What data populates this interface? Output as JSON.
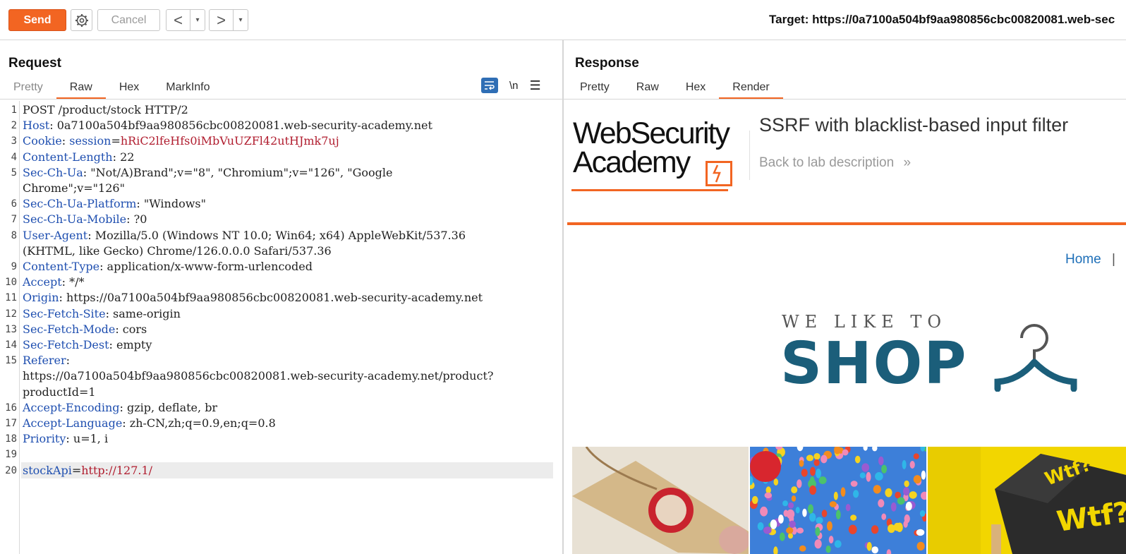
{
  "toolbar": {
    "send_label": "Send",
    "cancel_label": "Cancel",
    "back_arrow": "<",
    "forward_arrow": ">",
    "dropdown_glyph": "▾",
    "target_text": "Target: https://0a7100a504bf9aa980856cbc00820081.web-sec"
  },
  "request": {
    "title": "Request",
    "tabs": [
      "Pretty",
      "Raw",
      "Hex",
      "MarkInfo"
    ],
    "active_tab": "Raw",
    "newline_toggle": "\\n",
    "menu_glyph": "☰",
    "lines": [
      {
        "n": "1",
        "parts": [
          {
            "t": "POST /product/stock HTTP/2",
            "c": ""
          }
        ]
      },
      {
        "n": "2",
        "parts": [
          {
            "t": "Host",
            "c": "k"
          },
          {
            "t": ": 0a7100a504bf9aa980856cbc00820081.web-security-academy.net",
            "c": ""
          }
        ]
      },
      {
        "n": "3",
        "parts": [
          {
            "t": "Cookie",
            "c": "k"
          },
          {
            "t": ": ",
            "c": ""
          },
          {
            "t": "session",
            "c": "k"
          },
          {
            "t": "=",
            "c": ""
          },
          {
            "t": "hRiC2lfeHfs0iMbVuUZFl42utHJmk7uj",
            "c": "v"
          }
        ]
      },
      {
        "n": "4",
        "parts": [
          {
            "t": "Content-Length",
            "c": "k"
          },
          {
            "t": ": 22",
            "c": ""
          }
        ]
      },
      {
        "n": "5",
        "parts": [
          {
            "t": "Sec-Ch-Ua",
            "c": "k"
          },
          {
            "t": ": \"Not/A)Brand\";v=\"8\", \"Chromium\";v=\"126\", \"Google",
            "c": ""
          }
        ]
      },
      {
        "n": "",
        "parts": [
          {
            "t": "Chrome\";v=\"126\"",
            "c": ""
          }
        ]
      },
      {
        "n": "6",
        "parts": [
          {
            "t": "Sec-Ch-Ua-Platform",
            "c": "k"
          },
          {
            "t": ": \"Windows\"",
            "c": ""
          }
        ]
      },
      {
        "n": "7",
        "parts": [
          {
            "t": "Sec-Ch-Ua-Mobile",
            "c": "k"
          },
          {
            "t": ": ?0",
            "c": ""
          }
        ]
      },
      {
        "n": "8",
        "parts": [
          {
            "t": "User-Agent",
            "c": "k"
          },
          {
            "t": ": Mozilla/5.0 (Windows NT 10.0; Win64; x64) AppleWebKit/537.36",
            "c": ""
          }
        ]
      },
      {
        "n": "",
        "parts": [
          {
            "t": "(KHTML, like Gecko) Chrome/126.0.0.0 Safari/537.36",
            "c": ""
          }
        ]
      },
      {
        "n": "9",
        "parts": [
          {
            "t": "Content-Type",
            "c": "k"
          },
          {
            "t": ": application/x-www-form-urlencoded",
            "c": ""
          }
        ]
      },
      {
        "n": "10",
        "parts": [
          {
            "t": "Accept",
            "c": "k"
          },
          {
            "t": ": */*",
            "c": ""
          }
        ]
      },
      {
        "n": "11",
        "parts": [
          {
            "t": "Origin",
            "c": "k"
          },
          {
            "t": ": https://0a7100a504bf9aa980856cbc00820081.web-security-academy.net",
            "c": ""
          }
        ]
      },
      {
        "n": "12",
        "parts": [
          {
            "t": "Sec-Fetch-Site",
            "c": "k"
          },
          {
            "t": ": same-origin",
            "c": ""
          }
        ]
      },
      {
        "n": "13",
        "parts": [
          {
            "t": "Sec-Fetch-Mode",
            "c": "k"
          },
          {
            "t": ": cors",
            "c": ""
          }
        ]
      },
      {
        "n": "14",
        "parts": [
          {
            "t": "Sec-Fetch-Dest",
            "c": "k"
          },
          {
            "t": ": empty",
            "c": ""
          }
        ]
      },
      {
        "n": "15",
        "parts": [
          {
            "t": "Referer",
            "c": "k"
          },
          {
            "t": ":",
            "c": ""
          }
        ]
      },
      {
        "n": "",
        "parts": [
          {
            "t": "https://0a7100a504bf9aa980856cbc00820081.web-security-academy.net/product?",
            "c": ""
          }
        ]
      },
      {
        "n": "",
        "parts": [
          {
            "t": "productId=1",
            "c": ""
          }
        ]
      },
      {
        "n": "16",
        "parts": [
          {
            "t": "Accept-Encoding",
            "c": "k"
          },
          {
            "t": ": gzip, deflate, br",
            "c": ""
          }
        ]
      },
      {
        "n": "17",
        "parts": [
          {
            "t": "Accept-Language",
            "c": "k"
          },
          {
            "t": ": zh-CN,zh;q=0.9,en;q=0.8",
            "c": ""
          }
        ]
      },
      {
        "n": "18",
        "parts": [
          {
            "t": "Priority",
            "c": "k"
          },
          {
            "t": ": u=1, i",
            "c": ""
          }
        ]
      },
      {
        "n": "19",
        "parts": []
      },
      {
        "n": "20",
        "parts": [
          {
            "t": "stockApi",
            "c": "k"
          },
          {
            "t": "=",
            "c": ""
          },
          {
            "t": "http://127.1/",
            "c": "v"
          }
        ],
        "highlight": true
      }
    ]
  },
  "response": {
    "title": "Response",
    "tabs": [
      "Pretty",
      "Raw",
      "Hex",
      "Render"
    ],
    "active_tab": "Render",
    "render": {
      "logo_line1": "WebSecurity",
      "logo_line2": "Academy",
      "lab_title": "SSRF with blacklist-based input filter",
      "back_link": "Back to lab description",
      "back_chevron": "»",
      "home_link": "Home",
      "nav_separator": "|",
      "shop_tagline": "WE LIKE TO",
      "shop_word": "SHOP"
    }
  },
  "colors": {
    "accent": "#f26522",
    "header_key": "#1f4fb0",
    "value_red": "#b01c2e",
    "link_blue": "#1e6fb8",
    "shop_blue": "#1b5e7a"
  }
}
